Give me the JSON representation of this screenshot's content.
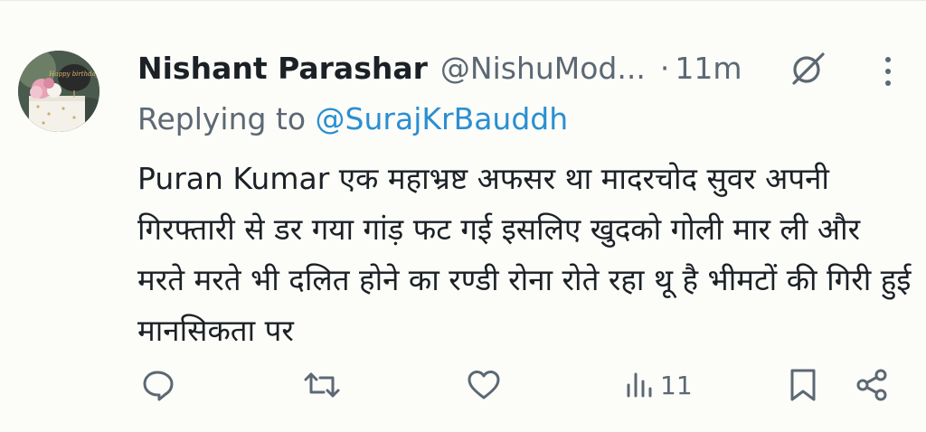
{
  "tweet": {
    "author_name": "Nishant Parashar",
    "author_handle": "@NishuMod...",
    "separator": "·",
    "time": "11m",
    "reply_prefix": "Replying to",
    "reply_mention": "@SurajKrBauddh",
    "text": "Puran Kumar एक महाभ्रष्ट अफसर था मादरचोद सुवर अपनी गिरफ्तारी से डर गया गांड़ फट गई इसलिए खुदको गोली मार ली और मरते मरते भी दलित होने का रण्डी रोना रोते रहा थू है भीमटों की गिरी हुई मानसिकता पर",
    "views": "11",
    "avatar_caption": "Happy birthday"
  },
  "icons": {
    "reply": "reply-icon",
    "retweet": "retweet-icon",
    "like": "heart-icon",
    "views": "views-icon",
    "bookmark": "bookmark-icon",
    "share": "share-icon",
    "grok": "grok-icon",
    "more": "more-vertical-icon"
  },
  "colors": {
    "background": "#fcfcf9",
    "text": "#1b2126",
    "muted": "#5c6873",
    "accent": "#2a8fd1"
  }
}
